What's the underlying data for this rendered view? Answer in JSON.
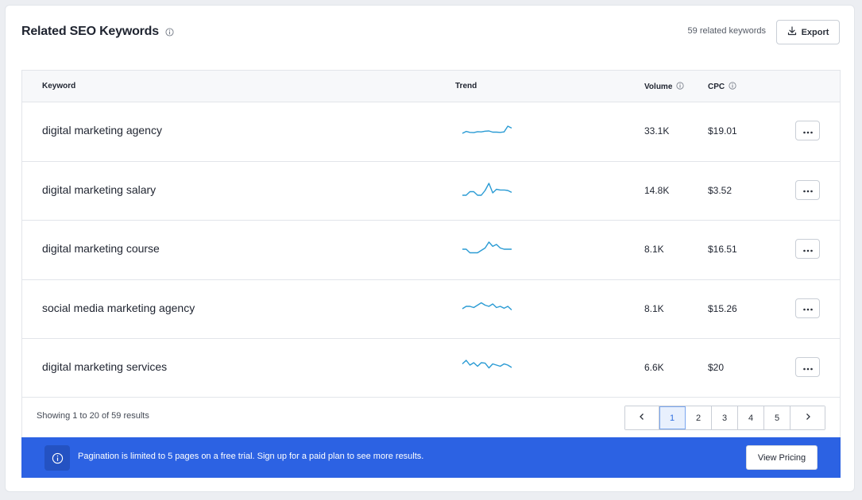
{
  "header": {
    "title": "Related SEO Keywords",
    "count_label": "59 related keywords",
    "export_label": "Export"
  },
  "columns": {
    "keyword": "Keyword",
    "trend": "Trend",
    "volume": "Volume",
    "cpc": "CPC"
  },
  "rows": [
    {
      "keyword": "digital marketing agency",
      "volume": "33.1K",
      "cpc": "$19.01",
      "trend": [
        50,
        42,
        46,
        47,
        43,
        44,
        41,
        40,
        45,
        45,
        46,
        44,
        20,
        28
      ]
    },
    {
      "keyword": "digital marketing salary",
      "volume": "14.8K",
      "cpc": "$3.52",
      "trend": [
        60,
        60,
        45,
        45,
        60,
        60,
        40,
        10,
        50,
        35,
        38,
        38,
        40,
        48
      ]
    },
    {
      "keyword": "digital marketing course",
      "volume": "8.1K",
      "cpc": "$16.51",
      "trend": [
        40,
        40,
        55,
        55,
        55,
        45,
        35,
        10,
        28,
        20,
        35,
        40,
        40,
        40
      ]
    },
    {
      "keyword": "social media marketing agency",
      "volume": "8.1K",
      "cpc": "$15.26",
      "trend": [
        40,
        30,
        30,
        35,
        25,
        15,
        25,
        30,
        20,
        35,
        30,
        38,
        30,
        45
      ]
    },
    {
      "keyword": "digital marketing services",
      "volume": "6.6K",
      "cpc": "$20",
      "trend": [
        25,
        10,
        30,
        20,
        35,
        20,
        22,
        42,
        25,
        30,
        35,
        25,
        30,
        40
      ]
    }
  ],
  "footer": {
    "showing": "Showing 1 to 20 of 59 results",
    "pages": [
      "1",
      "2",
      "3",
      "4",
      "5"
    ],
    "current_page": "1"
  },
  "banner": {
    "message": "Pagination is limited to 5 pages on a free trial. Sign up for a paid plan to see more results.",
    "button_label": "View Pricing"
  },
  "colors": {
    "accent": "#2c62e3",
    "trend_line": "#2a9bd4"
  }
}
